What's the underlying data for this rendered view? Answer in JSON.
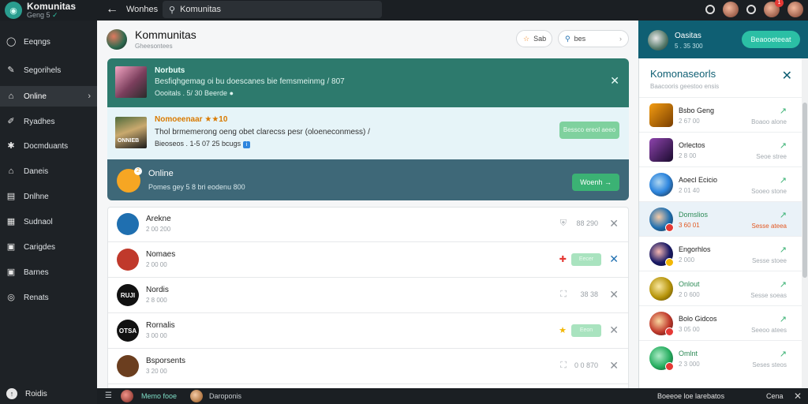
{
  "app": {
    "name": "Komunitas",
    "subtitle": "Geng 5",
    "subtitle_mark": "✓"
  },
  "topbar": {
    "back_icon": "arrow-left-icon",
    "breadcrumb": "Wonhes",
    "search_value": "Komunitas",
    "notification_count": "1"
  },
  "sidebar": {
    "items": [
      {
        "label": "Eeqngs",
        "icon": "circle-icon"
      },
      {
        "label": "Segorihels",
        "icon": "pencil-icon"
      },
      {
        "label": "Online",
        "icon": "home-icon",
        "active": true
      },
      {
        "label": "Ryadhes",
        "icon": "pin-icon"
      },
      {
        "label": "Docmduants",
        "icon": "gear-icon"
      },
      {
        "label": "Daneis",
        "icon": "house-icon"
      },
      {
        "label": "Dnlhne",
        "icon": "document-icon"
      },
      {
        "label": "Sudnaol",
        "icon": "grid-icon"
      },
      {
        "label": "Carigdes",
        "icon": "square-icon"
      },
      {
        "label": "Barnes",
        "icon": "square-icon"
      },
      {
        "label": "Renats",
        "icon": "circle-icon"
      }
    ],
    "bottom_label": "Roidis"
  },
  "channel": {
    "title": "Kommunitas",
    "subtitle": "Gheesontees",
    "star_label": "Sab",
    "search_value": "bes"
  },
  "banners": {
    "first": {
      "title": "Norbuts",
      "line1": "Besfiqhgemag oi bu doescanes bie femsmeinmg / 807",
      "line2": "Oooitals . 5/ 30 Beerde"
    },
    "second": {
      "thumb_label": "ONNIEB",
      "title": "Nomoeenaar ★★10",
      "line1": "Thol brmemerong oeng obet clarecss pesr (oloeneconmess) /",
      "line2": "Bieoseos . 1-5 07 25 bcugs",
      "action": "Bessco ereol aeeo"
    },
    "third": {
      "badge": "2",
      "title": "Online",
      "line1": "Pomes gey 5 8 bri eodenu 800",
      "action": "Woenh"
    }
  },
  "members": [
    {
      "name": "Arekne",
      "sub": "2 00 200",
      "meta": "88 290",
      "mid_icon": "shield-icon",
      "close_style": "gray",
      "avatar": "#1f6fb0",
      "avatar_text": ""
    },
    {
      "name": "Nomaes",
      "sub": "2 00 00",
      "chip": "Eecer",
      "mid_icon": "gift-icon",
      "close_style": "blue",
      "avatar": "#c0392b",
      "avatar_text": ""
    },
    {
      "name": "Nordis",
      "sub": "2 8 000",
      "meta": "38 38",
      "mid_icon": "lock-icon",
      "close_style": "gray",
      "avatar": "#111111",
      "avatar_text": "RUJI"
    },
    {
      "name": "Rornalis",
      "sub": "3 00 00",
      "chip": "Eeon",
      "mid_icon": "trophy-icon",
      "close_style": "gray",
      "avatar": "#111111",
      "avatar_text": "OTSA"
    },
    {
      "name": "Bsporsents",
      "sub": "3 20 00",
      "meta": "0 0 870",
      "mid_icon": "lock-icon",
      "close_style": "gray",
      "avatar": "#6b3e1f",
      "avatar_text": ""
    }
  ],
  "right": {
    "user_name": "Oasitas",
    "user_sub": "5 . 35 300",
    "join_label": "Beaooeteeat",
    "panel_title": "Komonaseorls",
    "panel_sub": "Baacooris geestoo ensis",
    "games": [
      {
        "name": "Bsbo Geng",
        "sub": "2 67 00",
        "val": "Boaoo alone",
        "color": "#f39c12",
        "shape": "sq"
      },
      {
        "name": "Orlectos",
        "sub": "2 8 00",
        "val": "Seoe stree",
        "color": "#5b2c83",
        "shape": "sq"
      },
      {
        "name": "Aoecl Ecicio",
        "sub": "2 01 40",
        "val": "Sooeo stone",
        "color": "#2e86de",
        "shape": "circle"
      },
      {
        "name": "Domslios",
        "sub": "3 60 01",
        "val": "Sesse ateea",
        "color": "#1f6fb0",
        "shape": "circle",
        "highlight": true
      },
      {
        "name": "Engorhlos",
        "sub": "2 000",
        "val": "Sesse stoee",
        "color": "#1a1a66",
        "shape": "circle"
      },
      {
        "name": "Onlout",
        "sub": "2 0 600",
        "val": "Sesse soeas",
        "color": "#b7950b",
        "shape": "circle"
      },
      {
        "name": "Bolo Gidcos",
        "sub": "3 05 00",
        "val": "Seeoo atees",
        "color": "#c0392b",
        "shape": "circle"
      },
      {
        "name": "Omlnt",
        "sub": "2 3 000",
        "val": "Seses steos",
        "color": "#27ae60",
        "shape": "circle"
      }
    ]
  },
  "bottombar": {
    "user1": "Memo fooe",
    "user2": "Daroponis",
    "right_text": "Boeeoe loe larebatos",
    "right_label": "Cena"
  }
}
